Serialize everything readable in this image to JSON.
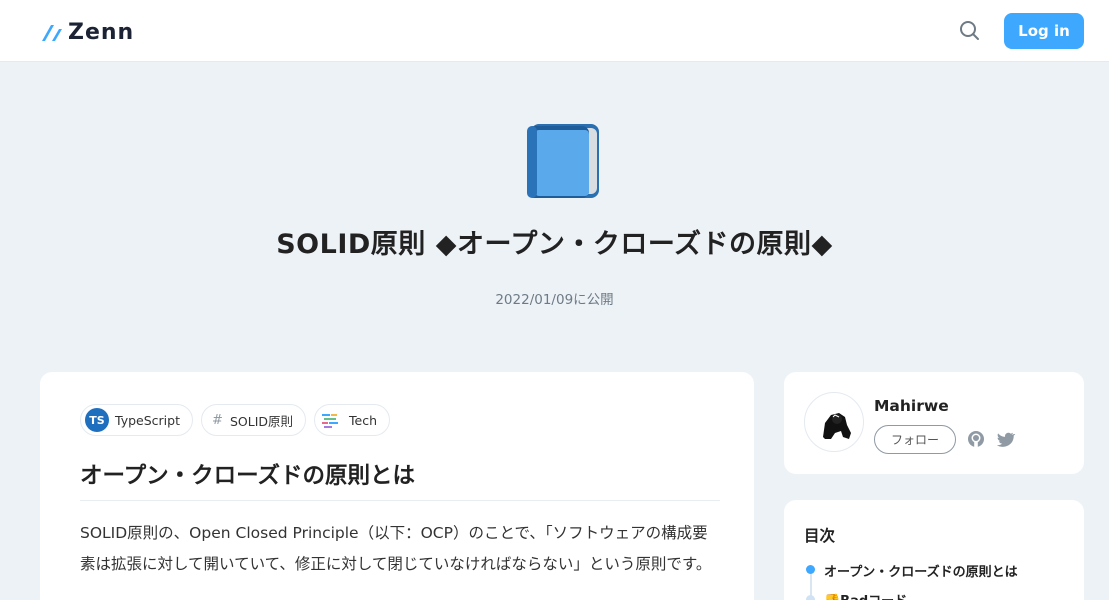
{
  "header": {
    "logo_text": "Zenn",
    "search_icon": "search-icon",
    "login_label": "Log in",
    "accent_color": "#3ea8ff"
  },
  "article": {
    "emoji": "blue-book-emoji",
    "title": "SOLID原則 ◆オープン・クローズドの原則◆",
    "published": "2022/01/09に公開",
    "topics": [
      {
        "label": "TypeScript",
        "icon": "typescript-icon"
      },
      {
        "label": "SOLID原則",
        "icon": "hash-icon"
      },
      {
        "label": "Tech",
        "icon": "tech-icon"
      }
    ],
    "section_heading": "オープン・クローズドの原則とは",
    "paragraph": "SOLID原則の、Open Closed Principle（以下：OCP）のことで、「ソフトウェアの構成要素は拡張に対して開いていて、修正に対して閉じていなければならない」という原則です。"
  },
  "author": {
    "name": "Mahirwe",
    "follow_label": "フォロー",
    "github_icon": "github-icon",
    "twitter_icon": "twitter-icon"
  },
  "toc": {
    "title": "目次",
    "items": [
      {
        "label": "オープン・クローズドの原則とは",
        "active": true
      },
      {
        "label": "👎Badコード",
        "active": false
      }
    ]
  }
}
